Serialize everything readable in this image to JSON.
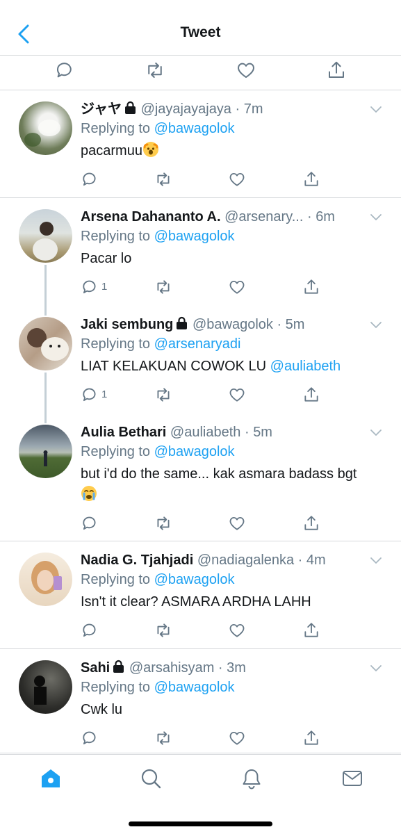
{
  "header": {
    "title": "Tweet"
  },
  "colors": {
    "accent": "#1da1f2",
    "muted": "#657786",
    "divider": "#d6d9dc"
  },
  "tweets": [
    {
      "name": "ジャヤ",
      "locked": true,
      "handle": "@jayajayajaya",
      "time": "7m",
      "replying_label": "Replying to",
      "reply_to": "@bawagolok",
      "text": "pacarmuu",
      "text_emoji": "shocked-face-emoji",
      "reply_count": "",
      "avatar": "cat-outdoors-photo"
    },
    {
      "name": "Arsena Dahananto A.",
      "locked": false,
      "handle": "@arsenary...",
      "time": "6m",
      "replying_label": "Replying to",
      "reply_to": "@bawagolok",
      "text": "Pacar lo",
      "reply_count": "1",
      "avatar": "man-on-beach-photo"
    },
    {
      "name": "Jaki sembung",
      "locked": true,
      "handle": "@bawagolok",
      "time": "5m",
      "replying_label": "Replying to",
      "reply_to": "@arsenaryadi",
      "text": "LIAT KELAKUAN COWOK LU",
      "mention": "@auliabeth",
      "reply_count": "1",
      "avatar": "girl-with-dog-photo"
    },
    {
      "name": "Aulia Bethari",
      "locked": false,
      "handle": "@auliabeth",
      "time": "5m",
      "replying_label": "Replying to",
      "reply_to": "@bawagolok",
      "text": "but i'd do the same... kak asmara badass bgt",
      "text_emoji": "crying-face-emoji",
      "reply_count": "",
      "avatar": "field-sky-photo"
    },
    {
      "name": "Nadia G. Tjahjadi",
      "locked": false,
      "handle": "@nadiagalenka",
      "time": "4m",
      "replying_label": "Replying to",
      "reply_to": "@bawagolok",
      "text": "Isn't it clear? ASMARA ARDHA LAHH",
      "reply_count": "",
      "avatar": "girl-selfie-photo"
    },
    {
      "name": "Sahi",
      "locked": true,
      "handle": "@arsahisyam",
      "time": "3m",
      "replying_label": "Replying to",
      "reply_to": "@bawagolok",
      "text": "Cwk lu",
      "reply_count": "",
      "avatar": "dark-silhouette-photo"
    }
  ],
  "tabs": [
    "home-icon",
    "search-icon",
    "notifications-icon",
    "messages-icon"
  ]
}
